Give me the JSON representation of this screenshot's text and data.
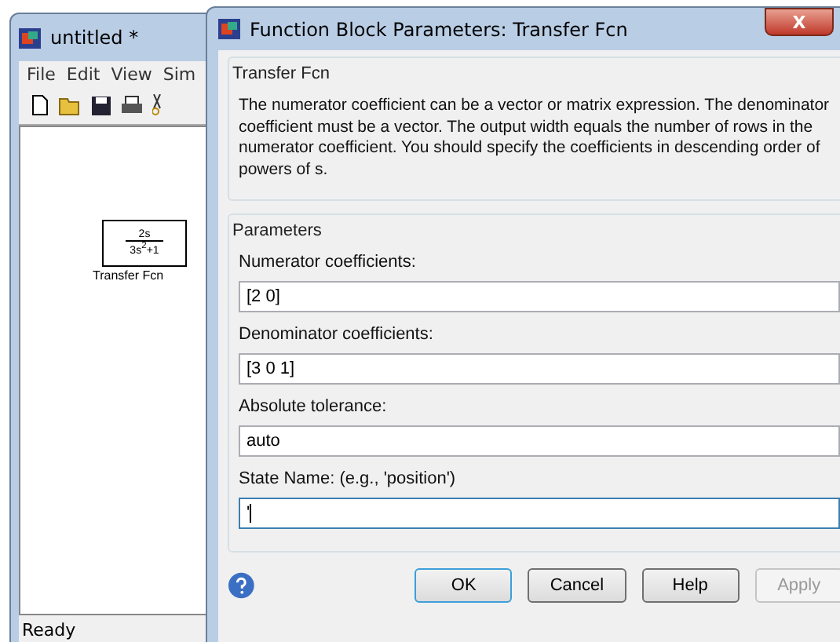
{
  "model_window": {
    "title": "untitled *",
    "menu": [
      "File",
      "Edit",
      "View",
      "Sim"
    ],
    "block": {
      "numerator": "2s",
      "denominator": "3s$^{2}$+1",
      "label": "Transfer Fcn"
    },
    "status_bar": "Ready"
  },
  "dialog": {
    "title": "Function Block Parameters: Transfer Fcn",
    "close": "X",
    "description_group": {
      "title": "Transfer Fcn",
      "text": "The numerator coefficient can be a vector or matrix expression. The denominator coefficient must be a vector. The output width equals the number of rows in the numerator coefficient. You should specify the coefficients in descending order of powers of s."
    },
    "parameters_group": {
      "title": "Parameters",
      "fields": [
        {
          "label": "Numerator coefficients:",
          "value": "[2 0]",
          "focused": false
        },
        {
          "label": "Denominator coefficients:",
          "value": "[3 0 1]",
          "focused": false
        },
        {
          "label": "Absolute tolerance:",
          "value": "auto",
          "focused": false
        },
        {
          "label": "State Name: (e.g., 'position')",
          "value": "'",
          "focused": true
        }
      ]
    },
    "buttons": [
      {
        "label": "OK",
        "default": true,
        "disabled": false
      },
      {
        "label": "Cancel",
        "default": false,
        "disabled": false
      },
      {
        "label": "Help",
        "default": false,
        "disabled": false
      },
      {
        "label": "Apply",
        "default": false,
        "disabled": true
      }
    ]
  }
}
